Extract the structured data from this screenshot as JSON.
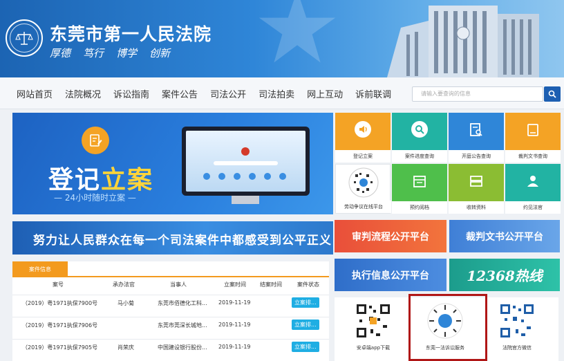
{
  "header": {
    "site_title": "东莞市第一人民法院",
    "motto": [
      "厚德",
      "笃行",
      "博学",
      "创新"
    ]
  },
  "nav": {
    "items": [
      "网站首页",
      "法院概况",
      "诉讼指南",
      "案件公告",
      "司法公开",
      "司法拍卖",
      "网上互动",
      "诉前联调"
    ],
    "search_placeholder": "请输入要查询的信息"
  },
  "banner": {
    "title_part1": "登记",
    "title_part2": "立案",
    "subtitle": "— 24小时随时立案 —"
  },
  "slogan": "努力让人民群众在每一个司法案件中都感受到公平正义",
  "tiles": [
    {
      "label": "登记立案",
      "color": "#f4a325",
      "icon": "speaker-icon"
    },
    {
      "label": "案件进度查询",
      "color": "#22b3a3",
      "icon": "magnifier-icon"
    },
    {
      "label": "开庭公告查询",
      "color": "#2f86d8",
      "icon": "document-search-icon"
    },
    {
      "label": "裁判文书查询",
      "color": "#f4a325",
      "icon": "book-icon"
    },
    {
      "label": "劳动争议在线平台",
      "color": "#ffffff",
      "icon": "qr-icon"
    },
    {
      "label": "预约阅档",
      "color": "#4fbf4b",
      "icon": "calendar-icon"
    },
    {
      "label": "收转资料",
      "color": "#8bbd33",
      "icon": "folder-icon"
    },
    {
      "label": "约见法官",
      "color": "#22b3a3",
      "icon": "judge-icon"
    }
  ],
  "platforms": [
    {
      "label": "审判流程公开平台",
      "color": "#e94f3a"
    },
    {
      "label": "裁判文书公开平台",
      "color": "#3f7fd6"
    },
    {
      "label": "执行信息公开平台",
      "color": "#2f6ec9"
    },
    {
      "label": "12368热线",
      "color": "#1c9c8c"
    }
  ],
  "case_info": {
    "tab": "案件信息",
    "columns": [
      "案号",
      "承办法官",
      "当事人",
      "立案时间",
      "结案时间",
      "案件状态"
    ],
    "rows": [
      {
        "case_no": "（2019）粤1971执保7900号",
        "judge": "马小菊",
        "party": "东莞市佰德化工科...",
        "filed": "2019-11-19",
        "closed": "",
        "status": "立案排..."
      },
      {
        "case_no": "（2019）粤1971执保7906号",
        "judge": "",
        "party": "东莞市莞深长城地...",
        "filed": "2019-11-19",
        "closed": "",
        "status": "立案排..."
      },
      {
        "case_no": "（2019）粤1971执保7905号",
        "judge": "肖荣庆",
        "party": "中国建设银行股份...",
        "filed": "2019-11-19",
        "closed": "",
        "status": "立案排..."
      }
    ]
  },
  "qr_codes": [
    {
      "label": "安卓端app下载"
    },
    {
      "label": "东莞一法诉讼服务"
    },
    {
      "label": "法院官方微信"
    }
  ]
}
